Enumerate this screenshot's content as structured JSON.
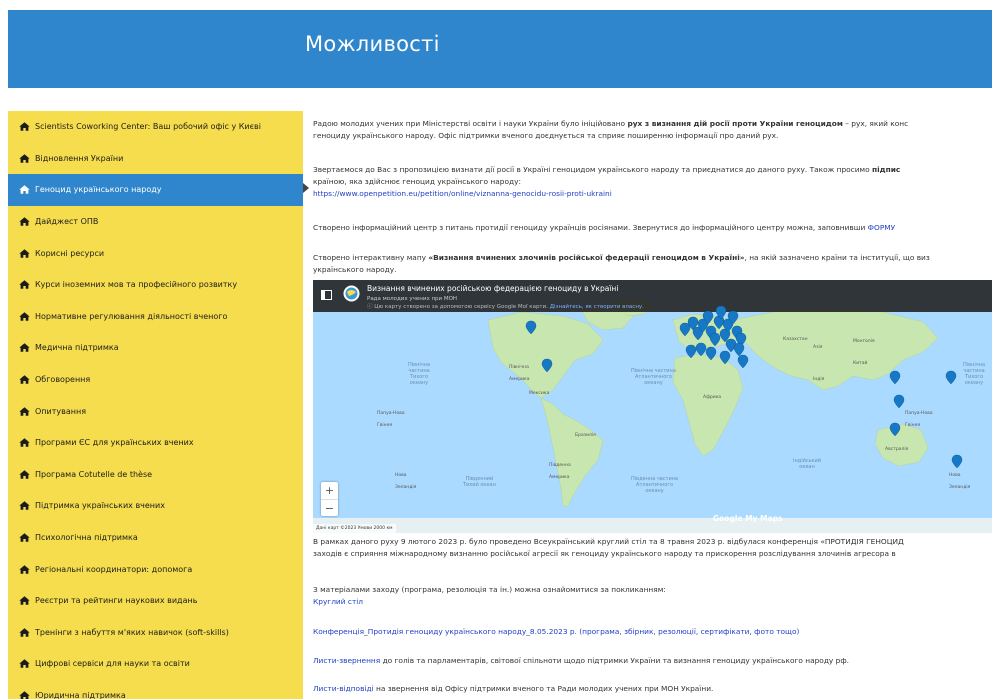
{
  "header": {
    "title": "Можливості"
  },
  "sidebar": {
    "active_index": 2,
    "items": [
      {
        "label": "Scientists Coworking Center: Ваш робочий офіс у Києві"
      },
      {
        "label": "Відновлення України"
      },
      {
        "label": "Геноцид українського народу"
      },
      {
        "label": "Дайджест ОПВ"
      },
      {
        "label": "Корисні ресурси"
      },
      {
        "label": "Курси іноземних мов та професійного розвитку"
      },
      {
        "label": "Нормативне регулювання діяльності вченого"
      },
      {
        "label": "Медична підтримка"
      },
      {
        "label": "Обговорення"
      },
      {
        "label": "Опитування"
      },
      {
        "label": "Програми ЄС для українських вчених"
      },
      {
        "label": "Програма Cotutelle de thèse"
      },
      {
        "label": "Підтримка українських вчених"
      },
      {
        "label": "Психологічна підтримка"
      },
      {
        "label": "Регіональні координатори: допомога"
      },
      {
        "label": "Реєстри та рейтинги наукових видань"
      },
      {
        "label": "Тренінги з набуття м'яких навичок (soft-skills)"
      },
      {
        "label": "Цифрові сервіси для науки та освіти"
      },
      {
        "label": "Юридична підтримка"
      }
    ]
  },
  "content": {
    "p1a": "Радою молодих учених при Міністерстві освіти і науки України було ініційовано ",
    "p1b": "рух з визнання дій росії проти України геноцидом",
    "p1c": " – рух, який конс",
    "p1d": "геноциду українського народу. Офіс підтримки вченого доєднується та сприяє поширенню інформації про даний рух.",
    "p2a": "Звертаємося до Вас з пропозицією визнати дії росії в Україні геноцидом українського народу та приєднатися до даного руху. Також просимо ",
    "p2b": "підпис",
    "p2c": "країною, яка здійснює геноцид українського народу:",
    "petition_link": "https://www.openpetition.eu/petition/online/viznanna-genocidu-rosii-proti-ukraini",
    "p3a": "Створено інформаційний центр з питань протидії геноциду українців росіянами. Звернутися до інформаційного центру можна, заповнивши ",
    "p3b": "ФОРМУ",
    "p4a": "Створено інтерактивну мапу ",
    "p4b": "«Визнання вчинених злочинів російської федерації геноцидом в Україні»",
    "p4c": ", на якій зазначено країни та інституції, що виз",
    "p4d": "українського народу.",
    "p5a": "В рамках даного руху 9 лютого 2023 р. було проведено Всеукраїнський круглий стіл та 8 травня 2023 р. відбулася конференція «ПРОТИДІЯ ГЕНОЦИД",
    "p5b": "заходів є сприяння міжнародному визнанню російської агресії як геноциду українського народу та прискорення розслідування злочинів агресора в",
    "p6": "З матеріалами заходу (програма, резолюція та ін.) можна ознайомитися за покликанням:",
    "link_round_table": "Круглий стіл",
    "link_conference": "Конференція_Протидія геноциду українського народу_8.05.2023 р. (програма, збірник, резолюції, сертифікати, фото тощо)",
    "link_letters": "Листи-звернення",
    "letters_text": " до голів та парламентарів, світової спільноти щодо підтримки України та визнання геноциду українського народу рф.",
    "link_replies": "Листи-відповіді",
    "replies_text": " на звернення від Офісу підтримки вченого та Ради молодих учених при МОН України."
  },
  "map": {
    "title": "Визнання вчинених російською федерацією геноциду в Україні",
    "subtitle": "Рада молодих учених при МОН",
    "note": "Цю карту створено за допомогою сервісу Google Мої карти.",
    "note_link": "Дізнайтесь, як створити власну.",
    "brand": "Google My Maps",
    "footer": "Дані карт ©2023   Умови   2000 км",
    "oceans": {
      "north_pacific": "Північна\nчастина\nТихого\nокеану",
      "north_atlantic": "Північна частина\nАтлантичного\nокеану",
      "south_pacific": "Південний\nТихий океан",
      "south_atlantic": "Південна частина\nАтлантичного\nокеану",
      "indian": "Індійський\nокеан",
      "north_pacific_east": "Північна\nчастина\nТихого\nокеану"
    },
    "labels": {
      "north_america": "Північна\nАмерика",
      "south_america": "Південна\nАмерика",
      "africa": "Африка",
      "asia": "Азія",
      "australia": "Австралія",
      "kazakhstan": "Казахстан",
      "mongolia": "Монголія",
      "china": "Китай",
      "india": "Індія",
      "brazil": "Бразилія",
      "mexico": "Мексика",
      "png_left": "Папуа-Нова\nГвінея",
      "png_right": "Папуа-Нова\nГвінея",
      "nz_left": "Нова\nЗеландія",
      "nz_right": "Нова\nЗеландія"
    },
    "zoom_in": "+",
    "zoom_out": "−"
  }
}
